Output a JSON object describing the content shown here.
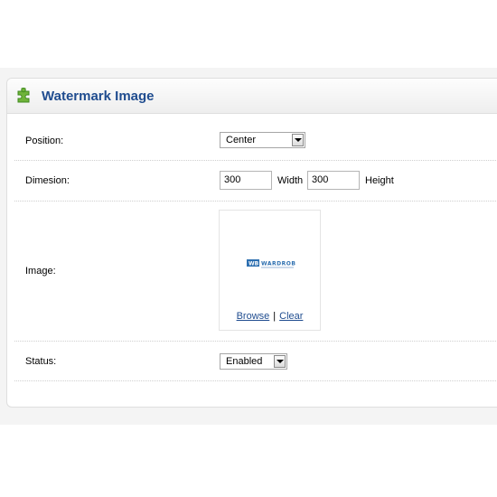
{
  "panel": {
    "title": "Watermark Image",
    "icon": "puzzle-icon",
    "icon_color": "#6fb33a"
  },
  "fields": {
    "position": {
      "label": "Position:",
      "value": "Center"
    },
    "dimension": {
      "label": "Dimesion:",
      "width_value": "300",
      "width_label": "Width",
      "height_value": "300",
      "height_label": "Height"
    },
    "image": {
      "label": "Image:",
      "logo": "wb-wardrobe-logo",
      "logo_text": "WB WARDROBE",
      "browse_label": "Browse",
      "separator": "|",
      "clear_label": "Clear"
    },
    "status": {
      "label": "Status:",
      "value": "Enabled"
    }
  },
  "colors": {
    "title": "#1f4c8f",
    "link": "#1f4c8f"
  }
}
